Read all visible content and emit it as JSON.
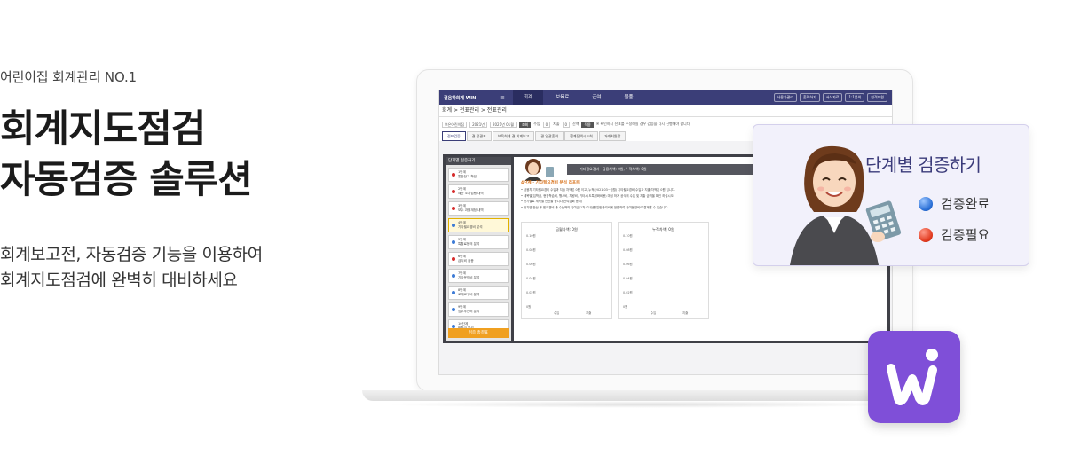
{
  "hero": {
    "tagline": "어린이집 회계관리 NO.1",
    "headline_line1": "회계지도점검",
    "headline_line2": "자동검증 솔루션",
    "desc_line1": "회계보고전, 자동검증 기능을 이용하여",
    "desc_line2": "회계지도점검에 완벽히 대비하세요"
  },
  "app": {
    "brand": "결음하회계 WIN",
    "nav": [
      "회계",
      "보육료",
      "급여",
      "물품"
    ],
    "utilities": [
      "사용자관리",
      "출력하기",
      "서식자료",
      "1:1문의",
      "원격지원"
    ],
    "breadcrumb": "회계 > 전표관리 > 전표관리",
    "filter": {
      "org": "보은어린이집",
      "year": "2021년",
      "month": "2021년 01월",
      "search_label": "조회",
      "income_label": "수입",
      "income_value": "0",
      "expense_label": "지출",
      "expense_value": "0",
      "balance_label": "잔액",
      "apply_label": "적용",
      "note": "※ 확인하시 전표를 수정하실 경우 검증을 다시 진행해야 합니다"
    },
    "tabs": [
      "전표검증",
      "결 정결표",
      "보육회계 결 회계보고",
      "결 일괄출력",
      "협계전액시조회",
      "거래처원장"
    ],
    "steps_title": "단계별 검증하기",
    "steps": [
      {
        "num": "1단계",
        "label": "통장잔고 확인",
        "status": "red"
      },
      {
        "num": "2단계",
        "label": "예산 조과집행 내역",
        "status": "red"
      },
      {
        "num": "3단계",
        "label": "보수 과쁠계정 내역",
        "status": "red"
      },
      {
        "num": "4단계",
        "label": "기타필요경비 분석",
        "status": "blue"
      },
      {
        "num": "5단계",
        "label": "특활료등의 분석",
        "status": "blue"
      },
      {
        "num": "6단계",
        "label": "급식비 검증",
        "status": "red"
      },
      {
        "num": "7단계",
        "label": "기타운영비 분석",
        "status": "blue"
      },
      {
        "num": "8단계",
        "label": "교재교구비 분석",
        "status": "blue"
      },
      {
        "num": "9단계",
        "label": "업무추진비 분석",
        "status": "blue"
      },
      {
        "num": "10단계",
        "label": "반환금 분석",
        "status": "blue"
      }
    ],
    "steps_button": "검증 총결표",
    "panel_bar": "기타필요경비 · 금융차액: 0원, 누적차액: 0원",
    "panel_title": "4단계 · 기타필요경비 분석 리포트",
    "panel_lines": [
      "• 금융차 기타필요경비 수입과 지출 차액은 0원 이고, 누적(2021.03~금월) 기타필요경비 수입과 지출 차액은 0원 입니다.",
      "• 세목별(입학금, 현장학습비, 행사비, 차량비, 기타시 도특성화비용) 마팅 하게 공식비 수입 및 지출 금액을 확인 하십시오.",
      "• 반기별로 세목별 잔산을 합니다(잔여금회 등시)",
      "• 반기별 잔산 후 필요경비 총 수납액의 잉여금(1차 이내)를 일반관리비에 전환하여 잔여운영비로 결재할 수 있습니다."
    ],
    "charts": [
      {
        "title": "금월차액: 0원",
        "ticks": [
          "0.10원",
          "0.08원",
          "0.06원",
          "0.04원",
          "0.02원",
          "0원"
        ],
        "bars": [
          "수입",
          "지출"
        ]
      },
      {
        "title": "누적차액: 0원",
        "ticks": [
          "0.10원",
          "0.08원",
          "0.06원",
          "0.04원",
          "0.02원",
          "0원"
        ],
        "bars": [
          "수입",
          "지출"
        ]
      }
    ]
  },
  "card": {
    "title": "단계별 검증하기",
    "legend_done": "검증완료",
    "legend_needed": "검증필요",
    "done_color": "#2a6fd6",
    "needed_color": "#e23a1f"
  },
  "badge": {
    "letter": "W",
    "color": "#7f4fd8"
  }
}
